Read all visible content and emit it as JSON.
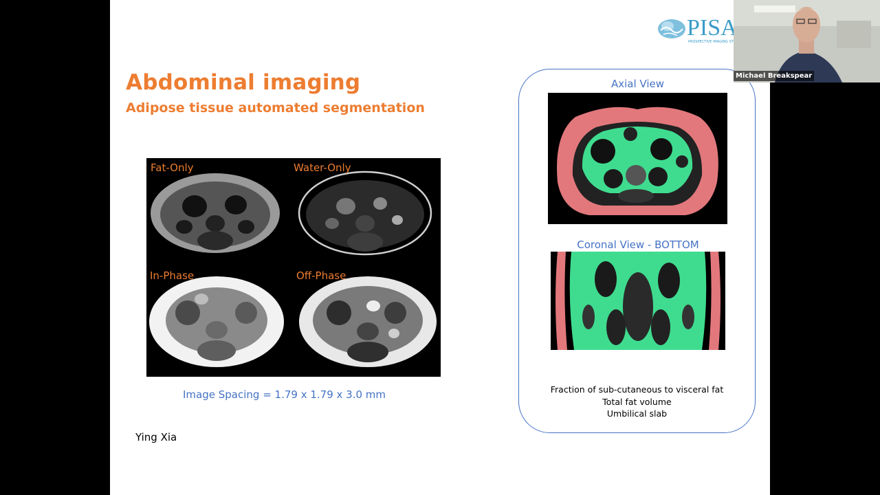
{
  "slide": {
    "title": "Abdominal imaging",
    "subtitle": "Adipose tissue automated segmentation",
    "logo": {
      "text": "PISA",
      "tagline": "PROSPECTIVE IMAGING STUDY"
    },
    "mri_panels": [
      {
        "label": "Fat-Only"
      },
      {
        "label": "Water-Only"
      },
      {
        "label": "In-Phase"
      },
      {
        "label": "Off-Phase"
      }
    ],
    "image_spacing": "Image Spacing = 1.79 x 1.79 x 3.0 mm",
    "author": "Ying Xia",
    "right_panel": {
      "axial_title": "Axial View",
      "coronal_title": "Coronal View - BOTTOM",
      "notes": [
        "Fraction of sub-cutaneous to visceral fat",
        "Total fat volume",
        "Umbilical slab"
      ]
    },
    "colors": {
      "accent": "#ED7D31",
      "blue": "#4472C4",
      "subcutaneous_fat": "#E2787C",
      "visceral_fat": "#3FDC8F"
    }
  },
  "webcam": {
    "participant_name": "Michael Breakspear"
  }
}
